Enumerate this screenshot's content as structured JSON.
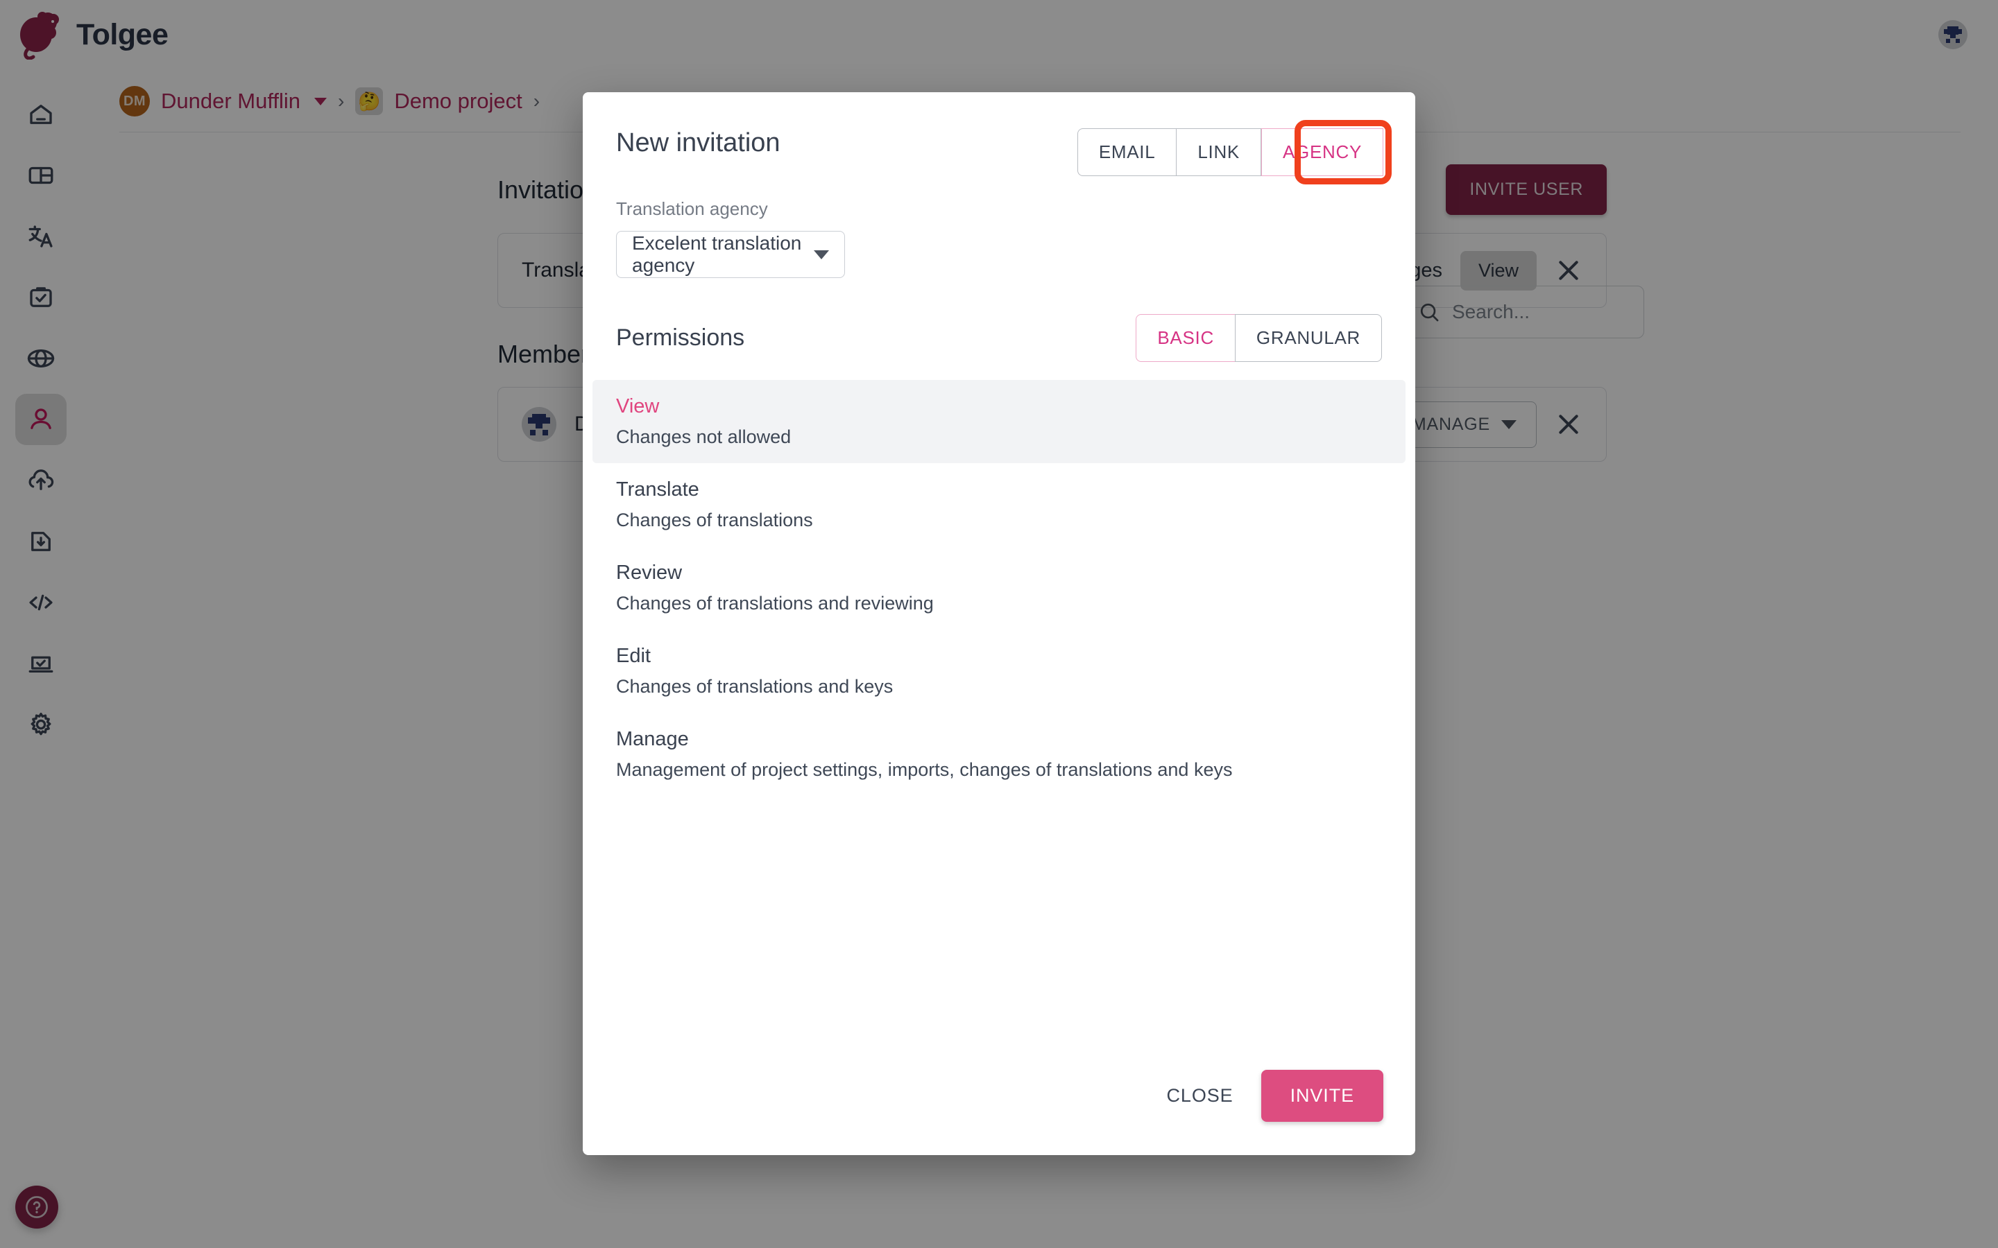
{
  "app": {
    "brand": "Tolgee",
    "logo_icon": "tolgee-mouse-logo",
    "user_avatar_icon": "user-identicon-avatar",
    "help_icon": "help-question-icon"
  },
  "sidebar": {
    "items": [
      {
        "name": "home",
        "icon": "home-icon"
      },
      {
        "name": "dashboard",
        "icon": "dashboard-panels-icon"
      },
      {
        "name": "translate",
        "icon": "translate-icon"
      },
      {
        "name": "tasks",
        "icon": "tasks-clipboard-check-icon"
      },
      {
        "name": "languages",
        "icon": "globe-icon"
      },
      {
        "name": "members",
        "icon": "person-icon",
        "active": true
      },
      {
        "name": "import",
        "icon": "cloud-upload-icon"
      },
      {
        "name": "export",
        "icon": "file-download-icon"
      },
      {
        "name": "developer",
        "icon": "code-brackets-icon"
      },
      {
        "name": "integrate",
        "icon": "laptop-check-icon"
      },
      {
        "name": "settings",
        "icon": "gear-icon"
      }
    ]
  },
  "breadcrumb": {
    "org_initials": "DM",
    "org_name": "Dunder Mufflin",
    "separator": "›",
    "project_emoji": "🤔",
    "project_name": "Demo project"
  },
  "page": {
    "invitations": {
      "title": "Invitations",
      "invite_user_label": "INVITE USER",
      "row": {
        "name": "Translation ord",
        "languages": "anguages",
        "permission_chip": "View",
        "close_icon": "close-x-icon"
      }
    },
    "members": {
      "title": "Members",
      "search_placeholder": "Search...",
      "search_icon": "search-icon",
      "row": {
        "avatar_icon": "member-identicon-avatar",
        "name": "Dunder Mu",
        "manage_label": "MANAGE",
        "manage_caret_icon": "chevron-down-icon",
        "close_icon": "close-x-icon"
      }
    }
  },
  "dialog": {
    "title": "New invitation",
    "tabs": [
      {
        "label": "EMAIL",
        "selected": false
      },
      {
        "label": "LINK",
        "selected": false
      },
      {
        "label": "AGENCY",
        "selected": true,
        "highlighted": true
      }
    ],
    "agency_field": {
      "label": "Translation agency",
      "value": "Excelent translation agency",
      "caret_icon": "dropdown-triangle-icon"
    },
    "permissions": {
      "title": "Permissions",
      "modes": [
        {
          "label": "BASIC",
          "selected": true
        },
        {
          "label": "GRANULAR",
          "selected": false
        }
      ],
      "items": [
        {
          "name": "View",
          "desc": "Changes not allowed",
          "selected": true
        },
        {
          "name": "Translate",
          "desc": "Changes of translations",
          "selected": false
        },
        {
          "name": "Review",
          "desc": "Changes of translations and reviewing",
          "selected": false
        },
        {
          "name": "Edit",
          "desc": "Changes of translations and keys",
          "selected": false
        },
        {
          "name": "Manage",
          "desc": "Management of project settings, imports, changes of translations and keys",
          "selected": false
        }
      ]
    },
    "actions": {
      "close_label": "CLOSE",
      "invite_label": "INVITE"
    }
  },
  "colors": {
    "brand_dark": "#822447",
    "accent_pink": "#dd4d80",
    "selected_pink": "#d63384",
    "highlight_ring": "#f0401d",
    "text_dark": "#39414f"
  }
}
